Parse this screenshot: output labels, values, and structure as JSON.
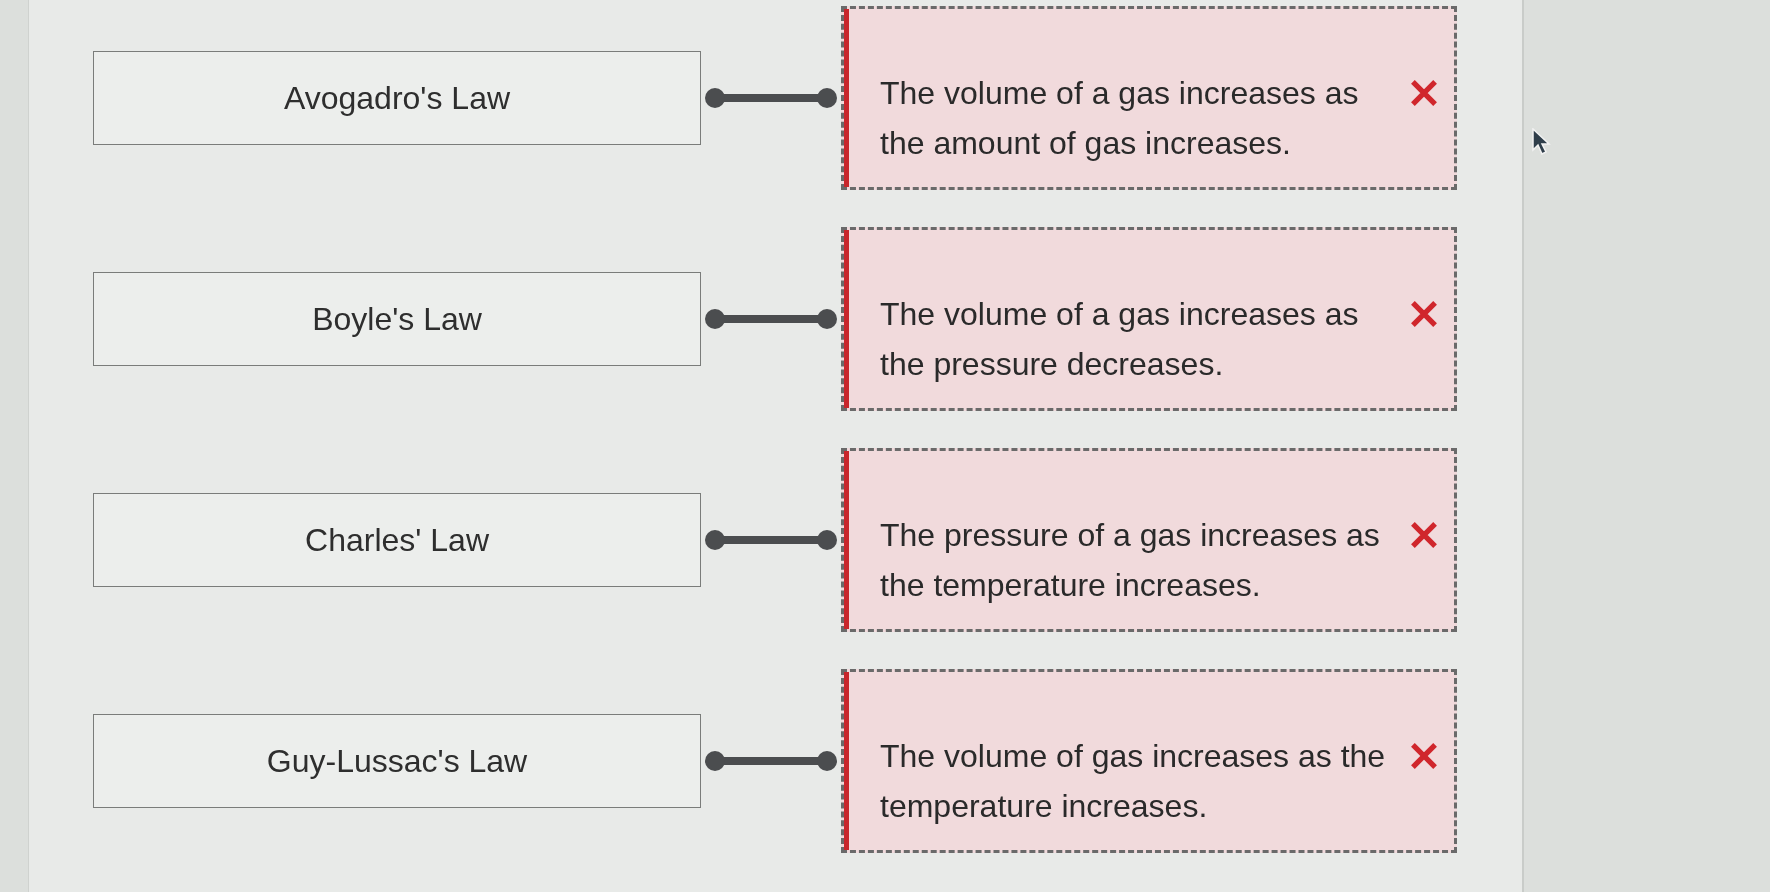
{
  "pairs": [
    {
      "term": "Avogadro's Law",
      "description": "The volume of a gas increases as the amount of gas increases.",
      "connected": true,
      "correct": false
    },
    {
      "term": "Boyle's Law",
      "description": "The volume of a gas increases as the pressure decreases.",
      "connected": true,
      "correct": false
    },
    {
      "term": "Charles' Law",
      "description": "The pressure of a gas increases as the temperature increases.",
      "connected": true,
      "correct": false
    },
    {
      "term": "Guy-Lussac's Law",
      "description": "The volume of gas increases as the temperature increases.",
      "connected": true,
      "correct": false
    }
  ]
}
